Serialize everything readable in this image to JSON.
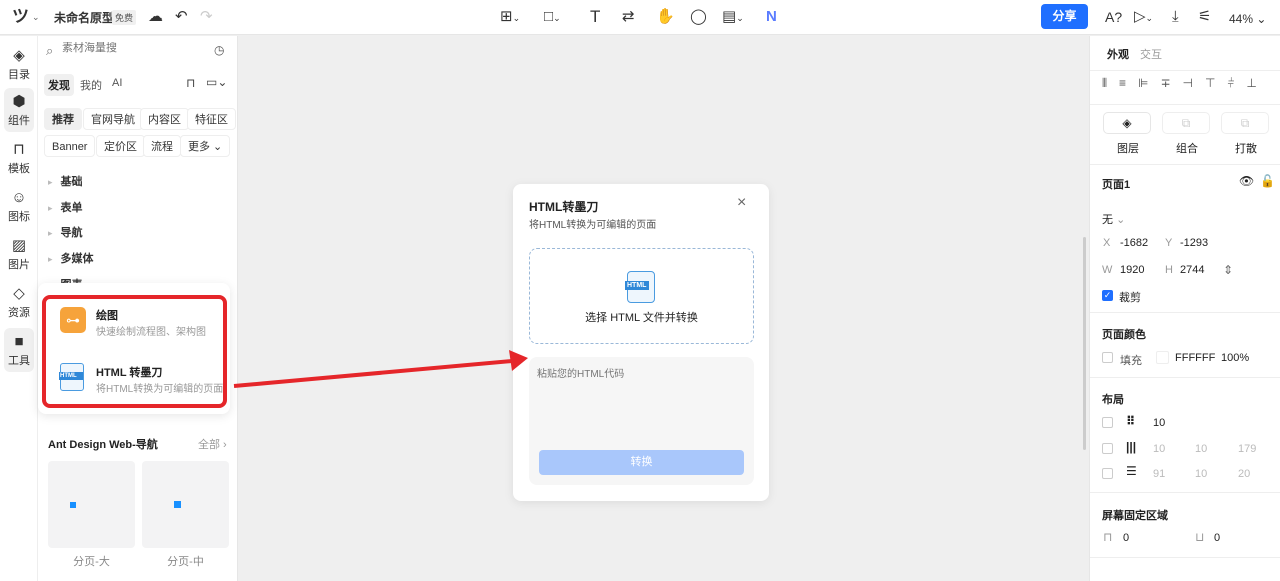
{
  "topbar": {
    "logo": "ツ",
    "doc_title": "未命名原型",
    "plan_badge": "免费",
    "share": "分享",
    "spellcheck": "A?",
    "zoom": "44%"
  },
  "rail": [
    {
      "label": "目录",
      "icon": "layers-icon"
    },
    {
      "label": "组件",
      "icon": "component-icon"
    },
    {
      "label": "模板",
      "icon": "template-icon"
    },
    {
      "label": "图标",
      "icon": "smile-icon"
    },
    {
      "label": "图片",
      "icon": "image-icon"
    },
    {
      "label": "资源",
      "icon": "resource-icon"
    },
    {
      "label": "工具",
      "icon": "tool-icon"
    }
  ],
  "sidebar": {
    "search_placeholder": "素材海量搜",
    "tabs": [
      "发现",
      "我的",
      "AI"
    ],
    "chips_row1": [
      "推荐",
      "官网导航",
      "内容区",
      "特征区"
    ],
    "chips_row2": [
      "Banner",
      "定价区",
      "流程",
      "更多"
    ],
    "categories": [
      "基础",
      "表单",
      "导航",
      "多媒体",
      "图表"
    ],
    "tools": [
      {
        "title": "绘图",
        "desc": "快速绘制流程图、架构图"
      },
      {
        "title": "HTML 转墨刀",
        "desc": "将HTML转换为可编辑的页面"
      }
    ],
    "library": {
      "title": "Ant Design Web-导航",
      "all": "全部",
      "items": [
        "分页-大",
        "分页-中"
      ]
    }
  },
  "dialog": {
    "title": "HTML转墨刀",
    "subtitle": "将HTML转换为可编辑的页面",
    "file_icon_text": "HTML",
    "upload_label": "选择 HTML 文件并转换",
    "textarea_placeholder": "粘贴您的HTML代码",
    "convert": "转换"
  },
  "right": {
    "tabs": [
      "外观",
      "交互"
    ],
    "actions": [
      "图层",
      "组合",
      "打散"
    ],
    "page_name": "页面1",
    "fill_mode": "无",
    "x_label": "X",
    "x": "-1682",
    "y_label": "Y",
    "y": "-1293",
    "w_label": "W",
    "w": "1920",
    "h_label": "H",
    "h": "2744",
    "clip": "裁剪",
    "page_color_title": "页面颜色",
    "fill_label": "填充",
    "color_hex": "FFFFFF",
    "opacity": "100%",
    "layout_title": "布局",
    "grid": "10",
    "columns": [
      "10",
      "10",
      "179"
    ],
    "rows": [
      "91",
      "10",
      "20"
    ],
    "fixed_title": "屏幕固定区域",
    "fixed_top": "0",
    "fixed_bottom": "0"
  },
  "colors": {
    "accent": "#1f6fff",
    "highlight": "#e5262a",
    "draw_icon": "#f6a33b"
  }
}
